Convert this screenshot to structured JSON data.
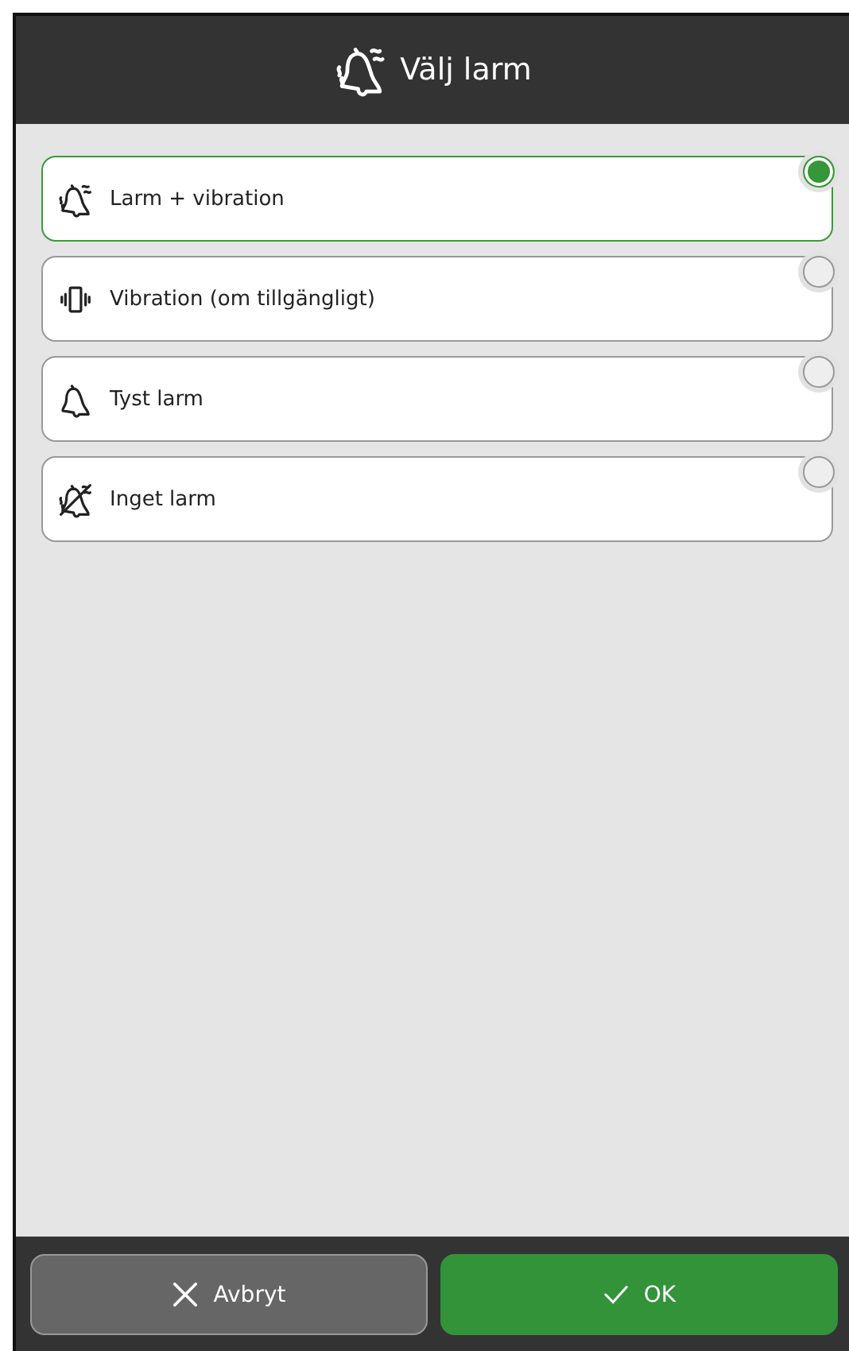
{
  "header": {
    "title": "Välj larm"
  },
  "options": [
    {
      "kind": "bell-vibrate",
      "label": "Larm + vibration",
      "selected": true
    },
    {
      "kind": "vibrate",
      "label": "Vibration (om tillgängligt)",
      "selected": false
    },
    {
      "kind": "bell",
      "label": "Tyst larm",
      "selected": false
    },
    {
      "kind": "bell-off",
      "label": "Inget larm",
      "selected": false
    }
  ],
  "buttons": [
    {
      "kind": "cancel",
      "label": "Avbryt"
    },
    {
      "kind": "ok",
      "label": "OK"
    }
  ]
}
